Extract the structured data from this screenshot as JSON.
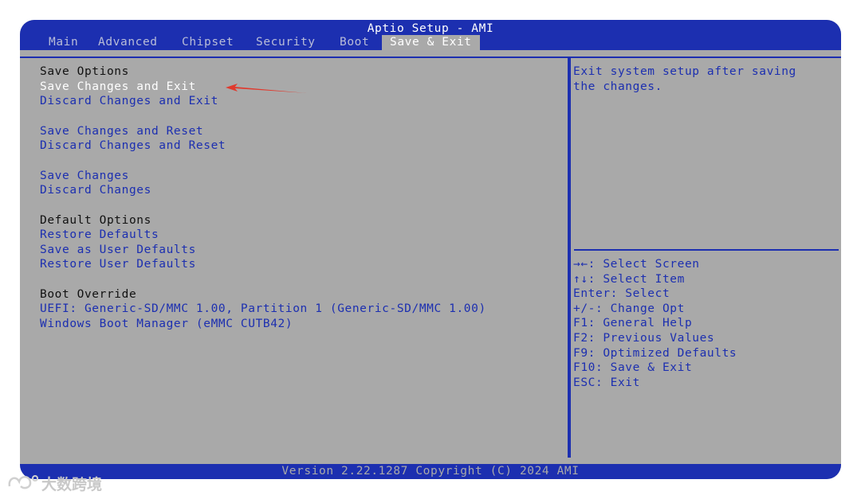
{
  "app": {
    "title": "Aptio Setup - AMI"
  },
  "tabs": [
    {
      "label": "Main"
    },
    {
      "label": "Advanced"
    },
    {
      "label": "Chipset"
    },
    {
      "label": "Security"
    },
    {
      "label": "Boot"
    },
    {
      "label": "Save & Exit",
      "active": true
    }
  ],
  "menu": {
    "save_options_header": "Save Options",
    "save_changes_and_exit": "Save Changes and Exit",
    "discard_changes_and_exit": "Discard Changes and Exit",
    "save_changes_and_reset": "Save Changes and Reset",
    "discard_changes_and_reset": "Discard Changes and Reset",
    "save_changes": "Save Changes",
    "discard_changes": "Discard Changes",
    "default_options_header": "Default Options",
    "restore_defaults": "Restore Defaults",
    "save_as_user_defaults": "Save as User Defaults",
    "restore_user_defaults": "Restore User Defaults",
    "boot_override_header": "Boot Override",
    "boot_uefi": "UEFI: Generic-SD/MMC 1.00, Partition 1 (Generic-SD/MMC 1.00)",
    "boot_windows": "Windows Boot Manager (eMMC CUTB42)"
  },
  "help": {
    "description_line1": "Exit system setup after saving",
    "description_line2": "the changes.",
    "keys": [
      "→←: Select Screen",
      "↑↓: Select Item",
      "Enter: Select",
      "+/-: Change Opt",
      "F1: General Help",
      "F2: Previous Values",
      "F9: Optimized Defaults",
      "F10: Save & Exit",
      "ESC: Exit"
    ]
  },
  "footer": {
    "version": "Version 2.22.1287 Copyright (C) 2024 AMI"
  },
  "watermark": {
    "text": "大数跨境"
  },
  "colors": {
    "bios_blue": "#1c2fb0",
    "bios_gray": "#a9a9a9",
    "annotation_red": "#e03a2e"
  }
}
